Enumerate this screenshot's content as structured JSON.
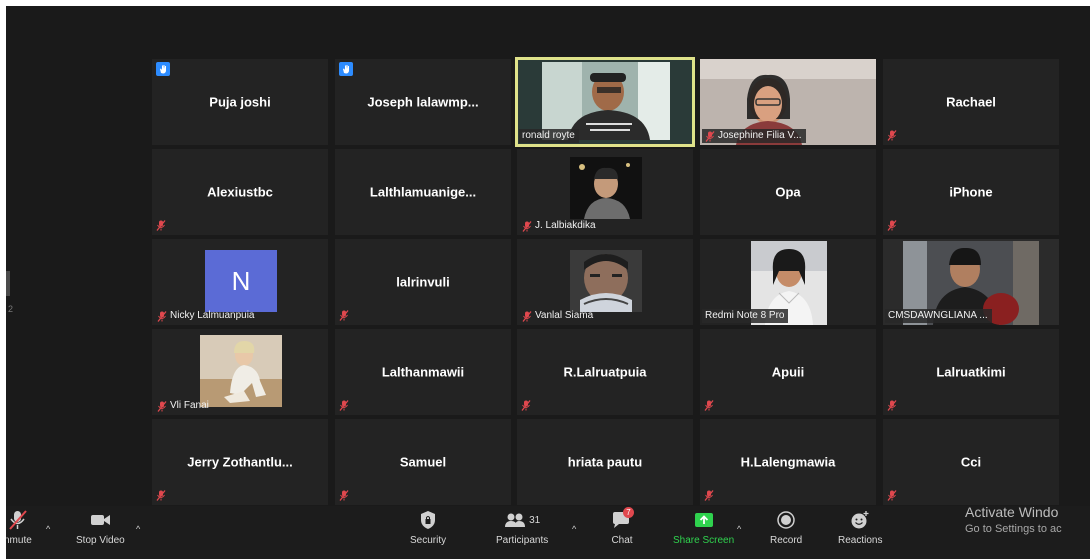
{
  "participants": [
    {
      "name": "Puja joshi"
    },
    {
      "name": "Joseph  lalawmp..."
    },
    {
      "label": "ronald royte"
    },
    {
      "label": "Josephine Filia V..."
    },
    {
      "name": "Rachael"
    },
    {
      "name": "Alexiustbc"
    },
    {
      "name": "Lalthlamuanige..."
    },
    {
      "label": "J. Lalbiakdika"
    },
    {
      "name": "Opa"
    },
    {
      "name": "iPhone"
    },
    {
      "label": "Nicky Lalmuanpuia",
      "avatar_letter": "N"
    },
    {
      "name": "lalrinvuli"
    },
    {
      "label": "Vanlal Siama"
    },
    {
      "label": "Redmi Note 8 Pro"
    },
    {
      "label": "CMSDAWNGLIANA ..."
    },
    {
      "label": "Vli Fanai"
    },
    {
      "name": "Lalthanmawii"
    },
    {
      "name": "R.Lalruatpuia"
    },
    {
      "name": "Apuii"
    },
    {
      "name": "Lalruatkimi"
    },
    {
      "name": "Jerry  Zothantlu..."
    },
    {
      "name": "Samuel"
    },
    {
      "name": "hriata pautu"
    },
    {
      "name": "H.Lalengmawia"
    },
    {
      "name": "Cci"
    }
  ],
  "side_number": "2",
  "toolbar": {
    "unmute": "nmute",
    "stop_video": "Stop Video",
    "security": "Security",
    "participants": "Participants",
    "participants_count": "31",
    "chat": "Chat",
    "chat_badge": "7",
    "share_screen": "Share Screen",
    "record": "Record",
    "reactions": "Reactions"
  },
  "watermark": {
    "title": "Activate Windo",
    "subtitle": "Go to Settings to ac"
  },
  "colors": {
    "background": "#1a1a1a",
    "tile": "#232323",
    "speaker_border": "#dfe28a",
    "raise_hand": "#2d8cff",
    "mute_red": "#e0484e",
    "share_green": "#2fd24e",
    "avatar": "#5b6bd6"
  }
}
